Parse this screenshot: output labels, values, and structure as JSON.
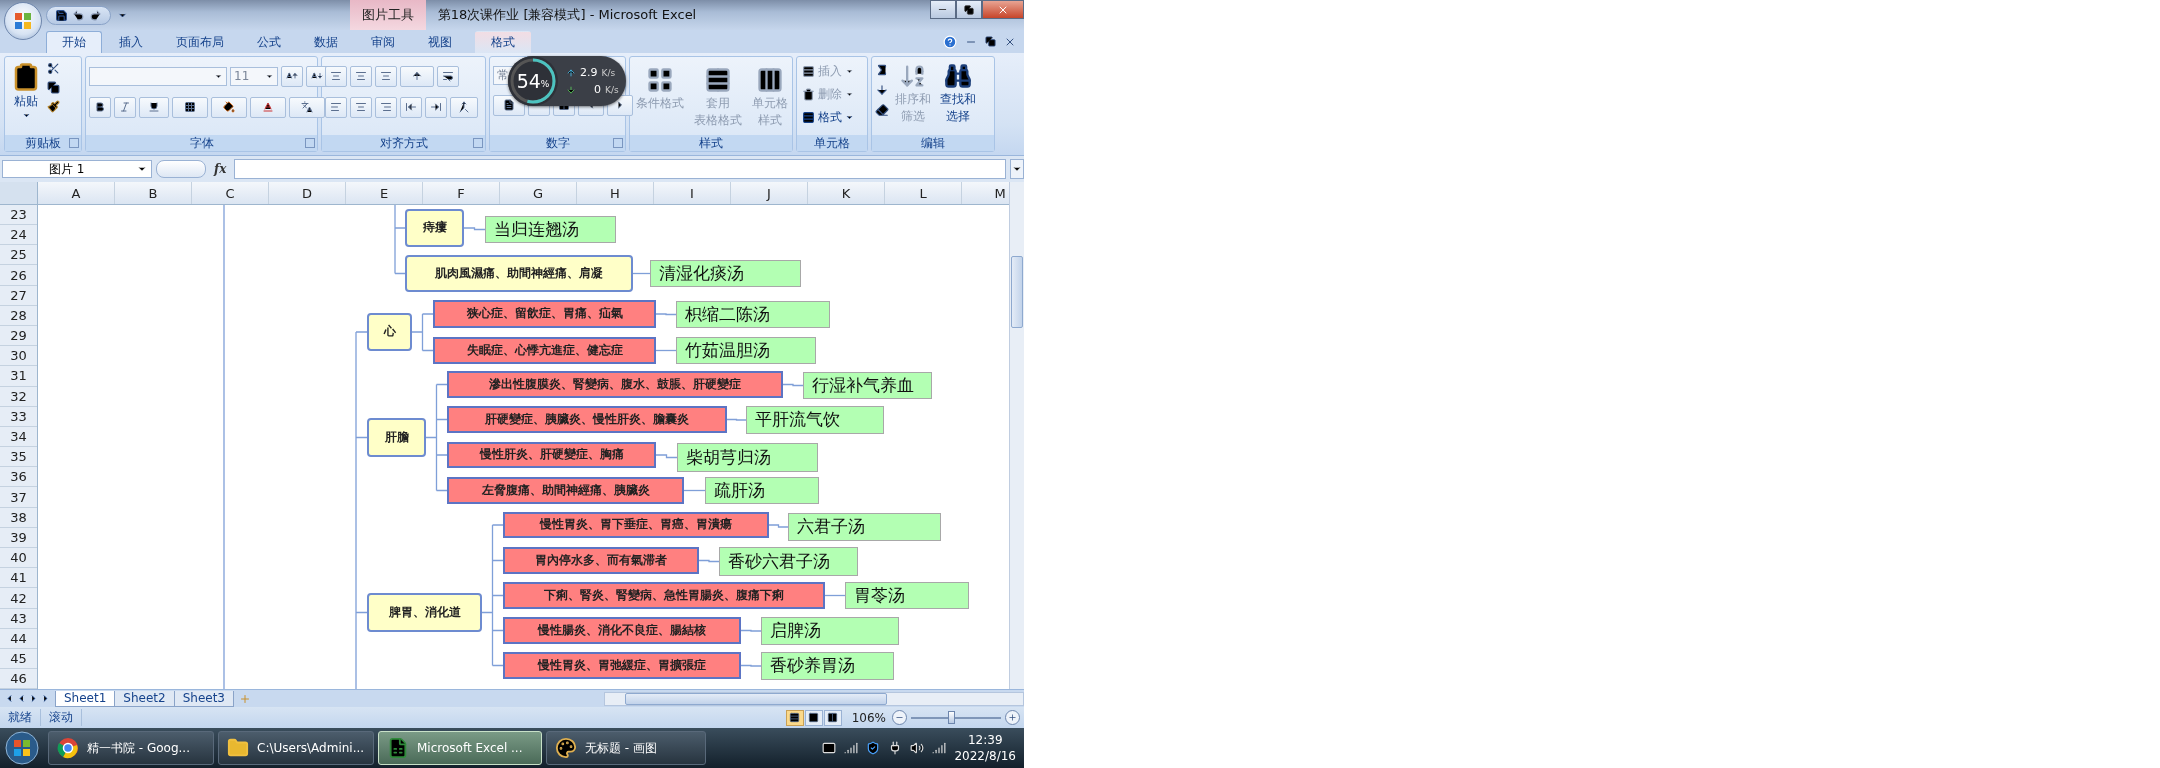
{
  "window": {
    "title": "第18次课作业  [兼容模式] - Microsoft Excel",
    "context_tool": "图片工具"
  },
  "tabs": [
    {
      "label": "开始",
      "selected": true
    },
    {
      "label": "插入",
      "selected": false
    },
    {
      "label": "页面布局",
      "selected": false
    },
    {
      "label": "公式",
      "selected": false
    },
    {
      "label": "数据",
      "selected": false
    },
    {
      "label": "审阅",
      "selected": false
    },
    {
      "label": "视图",
      "selected": false
    },
    {
      "label": "格式",
      "selected": false
    }
  ],
  "ribbon": {
    "groups": [
      {
        "kind": "clipboard",
        "label": "剪贴板",
        "buttons": [
          {
            "lines": [
              "粘贴"
            ],
            "disabled": false
          }
        ]
      },
      {
        "kind": "font",
        "label": "字体",
        "font_size": "11"
      },
      {
        "kind": "alignment",
        "label": "对齐方式"
      },
      {
        "kind": "number",
        "label": "数字",
        "format_field": "常"
      },
      {
        "kind": "styles",
        "label": "样式",
        "buttons": [
          {
            "lines": [
              "条件格式"
            ],
            "disabled": true
          },
          {
            "lines": [
              "套用",
              "表格格式"
            ],
            "disabled": true
          },
          {
            "lines": [
              "单元格",
              "样式"
            ],
            "disabled": true
          }
        ]
      },
      {
        "kind": "cells",
        "label": "单元格",
        "buttons": [
          {
            "lines": [
              "插入"
            ],
            "disabled": true
          },
          {
            "lines": [
              "删除"
            ],
            "disabled": true
          },
          {
            "lines": [
              "格式"
            ],
            "disabled": false
          }
        ]
      },
      {
        "kind": "editing",
        "label": "编辑",
        "buttons": [
          {
            "lines": [
              "排序和",
              "筛选"
            ],
            "disabled": true
          },
          {
            "lines": [
              "查找和",
              "选择"
            ],
            "disabled": false
          }
        ]
      }
    ]
  },
  "speed_widget": {
    "percent": "54",
    "percent_sign": "%",
    "level": 0.54,
    "upload": "2.9",
    "upload_unit": "K/s",
    "download": "0",
    "download_unit": "K/s"
  },
  "formula_bar": {
    "name_box": "图片 1",
    "fx": "fx"
  },
  "columns": [
    "A",
    "B",
    "C",
    "D",
    "E",
    "F",
    "G",
    "H",
    "I",
    "J",
    "K",
    "L",
    "M"
  ],
  "rows": [
    "23",
    "24",
    "25",
    "26",
    "27",
    "28",
    "29",
    "30",
    "31",
    "32",
    "33",
    "34",
    "35",
    "36",
    "37",
    "38",
    "39",
    "40",
    "41",
    "42",
    "43",
    "44",
    "45",
    "46"
  ],
  "mind_map": {
    "nodes": [
      {
        "kind": "category",
        "label": "痔瘻",
        "children": [
          {
            "kind": "formula",
            "label": "当归连翘汤"
          }
        ]
      },
      {
        "kind": "category",
        "label": "肌肉風濕痛、助間神經痛、肩凝",
        "children": [
          {
            "kind": "formula",
            "label": "清湿化痰汤"
          }
        ]
      },
      {
        "kind": "category",
        "label": "心",
        "children": [
          {
            "kind": "symptom",
            "label": "狭心症、留飲症、胃痛、疝氣",
            "children": [
              {
                "kind": "formula",
                "label": "枳缩二陈汤"
              }
            ]
          },
          {
            "kind": "symptom",
            "label": "失眠症、心悸亢進症、健忘症",
            "children": [
              {
                "kind": "formula",
                "label": "竹茹温胆汤"
              }
            ]
          }
        ]
      },
      {
        "kind": "category",
        "label": "肝膽",
        "children": [
          {
            "kind": "symptom",
            "label": "滲出性腹膜炎、腎變病、腹水、鼓脹、肝硬變症",
            "children": [
              {
                "kind": "formula",
                "label": "行湿补气养血"
              }
            ]
          },
          {
            "kind": "symptom",
            "label": "肝硬變症、胰臟炎、慢性肝炎、膽囊炎",
            "children": [
              {
                "kind": "formula",
                "label": "平肝流气饮"
              }
            ]
          },
          {
            "kind": "symptom",
            "label": "慢性肝炎、肝硬變症、胸痛",
            "children": [
              {
                "kind": "formula",
                "label": "柴胡芎归汤"
              }
            ]
          },
          {
            "kind": "symptom",
            "label": "左脅腹痛、助間神經痛、胰臟炎",
            "children": [
              {
                "kind": "formula",
                "label": "疏肝汤"
              }
            ]
          }
        ]
      },
      {
        "kind": "category",
        "label": "脾胃、消化道",
        "children": [
          {
            "kind": "symptom",
            "label": "慢性胃炎、胃下垂症、胃癌、胃潰瘍",
            "children": [
              {
                "kind": "formula",
                "label": "六君子汤"
              }
            ]
          },
          {
            "kind": "symptom",
            "label": "胃內停水多、而有氣滞者",
            "children": [
              {
                "kind": "formula",
                "label": "香砂六君子汤"
              }
            ]
          },
          {
            "kind": "symptom",
            "label": "下痢、腎炎、腎變病、急性胃腸炎、腹痛下痢",
            "children": [
              {
                "kind": "formula",
                "label": "胃苓汤"
              }
            ]
          },
          {
            "kind": "symptom",
            "label": "慢性腸炎、消化不良症、腸結核",
            "children": [
              {
                "kind": "formula",
                "label": "启脾汤"
              }
            ]
          },
          {
            "kind": "symptom",
            "label": "慢性胃炎、胃弛緩症、胃擴張症",
            "children": [
              {
                "kind": "formula",
                "label": "香砂养胃汤"
              }
            ]
          }
        ]
      }
    ]
  },
  "sheet_tabs": [
    {
      "label": "Sheet1",
      "selected": true
    },
    {
      "label": "Sheet2",
      "selected": false
    },
    {
      "label": "Sheet3",
      "selected": false
    }
  ],
  "status_bar": {
    "items": [
      "就绪",
      "滚动"
    ],
    "views": [
      {
        "kind": "normal",
        "selected": true
      },
      {
        "kind": "page_layout",
        "selected": false
      },
      {
        "kind": "page_break",
        "selected": false
      }
    ],
    "zoom": "106%",
    "level": 0.44
  },
  "taskbar": {
    "items": [
      {
        "kind": "browser",
        "label": "精一书院 - Goog...",
        "selected": false
      },
      {
        "kind": "folder",
        "label": "C:\\Users\\Admini...",
        "selected": false
      },
      {
        "kind": "spreadsheet",
        "label": "Microsoft Excel ...",
        "selected": true
      },
      {
        "kind": "paint",
        "label": "无标题 - 画图",
        "selected": false
      }
    ],
    "time": "12:39",
    "date": "2022/8/16"
  }
}
